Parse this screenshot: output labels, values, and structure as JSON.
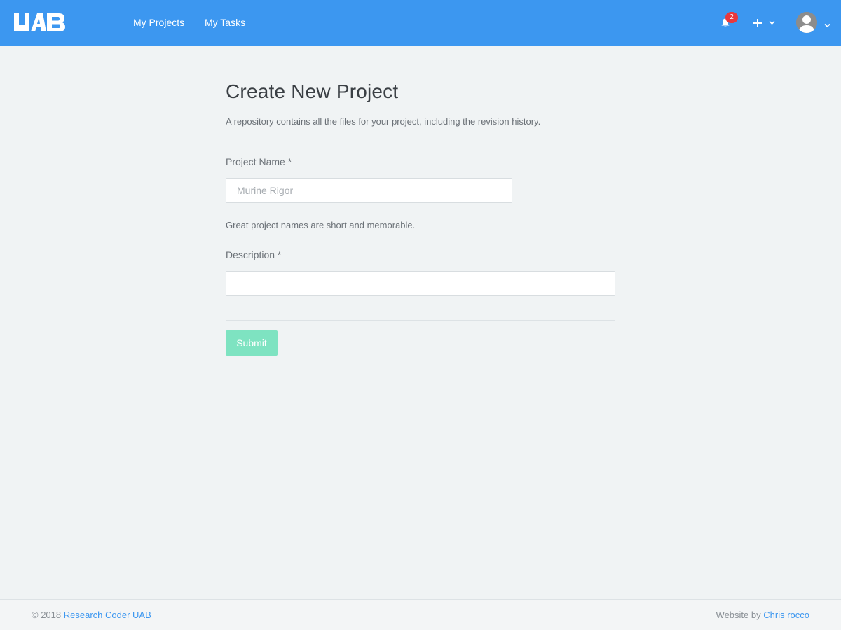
{
  "app": {
    "logo_text": "UAB"
  },
  "nav": {
    "links": [
      {
        "label": "My Projects"
      },
      {
        "label": "My Tasks"
      }
    ],
    "notifications": {
      "icon": "bell-icon",
      "count": "2"
    },
    "add_menu": {
      "icon": "plus-icon"
    },
    "user_menu": {
      "icon": "avatar"
    }
  },
  "page": {
    "title": "Create New Project",
    "subtitle": "A repository contains all the files for your project, including the revision history."
  },
  "form": {
    "project_name": {
      "label": "Project Name *",
      "value": "",
      "placeholder": "Murine Rigor",
      "help": "Great project names are short and memorable."
    },
    "description": {
      "label": "Description *",
      "value": "",
      "placeholder": ""
    },
    "submit_label": "Submit"
  },
  "footer": {
    "copyright_prefix": "© 2018",
    "copyright_link": "Research Coder UAB",
    "credit_prefix": "Website by",
    "credit_link": "Chris rocco"
  },
  "colors": {
    "navbar": "#3c97f0",
    "background": "#f0f3f4",
    "badge": "#e8383d",
    "submit_button": "#7ee3c1",
    "link": "#3c97f0"
  }
}
